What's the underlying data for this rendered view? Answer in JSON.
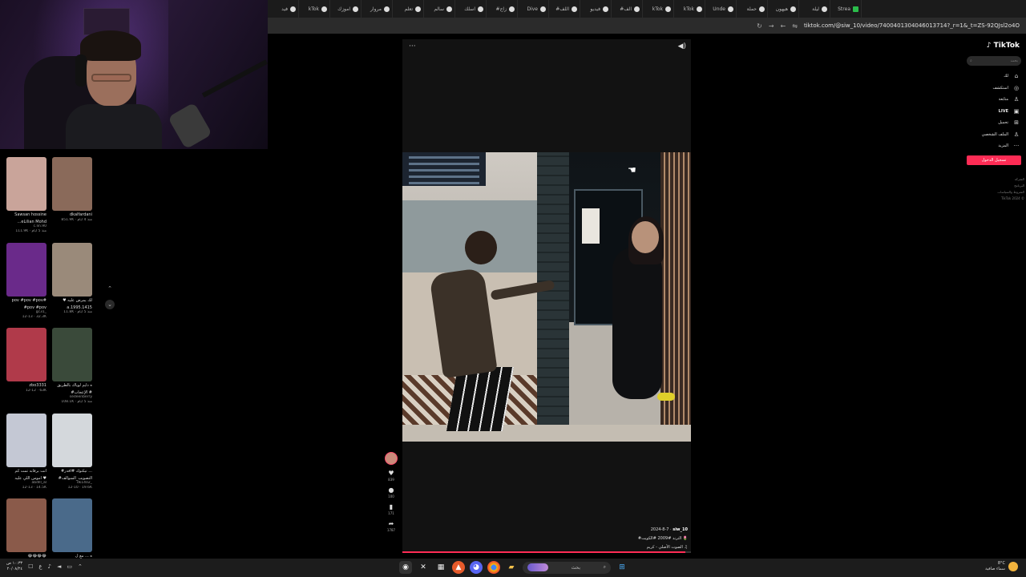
{
  "browser": {
    "tabs": [
      {
        "label": "فيد"
      },
      {
        "label": "kTok"
      },
      {
        "label": "اموزك"
      },
      {
        "label": "مروار"
      },
      {
        "label": "تعلم"
      },
      {
        "label": "سالم"
      },
      {
        "label": "اسلك"
      },
      {
        "label": "#زاج"
      },
      {
        "label": "Dive"
      },
      {
        "label": "#اللف"
      },
      {
        "label": "فيديو"
      },
      {
        "label": "#الف"
      },
      {
        "label": "kTok"
      },
      {
        "label": "kTok"
      },
      {
        "label": "Unde"
      },
      {
        "label": "حملة"
      },
      {
        "label": "هيهون"
      },
      {
        "label": "ليلة"
      },
      {
        "label": "Strea"
      }
    ],
    "url": "tiktok.com/@siw_10/video/7400401304046013714?_r=1&_t=ZS-92QJsl2o4O",
    "nav_back": "←",
    "nav_forward": "→",
    "reload": "↻"
  },
  "sidebar_grid": {
    "rows": [
      {
        "cards": [
          {
            "caption": "Sawsan hossine",
            "caption2": "...eLilian Mohd",
            "meta": "c.lin.90",
            "meta2": "111.9K · منذ 5 أيام",
            "color": "#c9a49a"
          },
          {
            "caption": "dkalfardani",
            "caption2": "",
            "meta": "851.9K · منذ 4 أيام",
            "meta2": "",
            "color": "#8a6a5a"
          }
        ]
      },
      {
        "cards": [
          {
            "caption": "pov #pov #pov#",
            "caption2": "#pov #pov",
            "meta": "gc31_",
            "meta2": "12-13 · 32.3K",
            "color": "#6a2a8a"
          },
          {
            "caption": "♥ لك يمرض عليه",
            "caption2": "a.1995.1415",
            "meta": "11.8K · منذ 5 أيام",
            "meta2": "",
            "color": "#9a8a7a"
          }
        ]
      },
      {
        "cards": [
          {
            "caption": "zbo3331",
            "caption2": "",
            "meta": "12-12 · 63K",
            "meta2": "",
            "color": "#b03a4a"
          },
          {
            "caption": "ه دايم لوياك بالطريق",
            "caption2": "#الإعجاب #",
            "meta": "sedeenberry",
            "meta2": "108.1K · منذ 5 أيام",
            "color": "#3a4a3a"
          }
        ]
      },
      {
        "cards": [
          {
            "caption": "انت برقابه تمت كم",
            "caption2": "اموس اللي عليه ♥",
            "meta": "abdlll_al",
            "meta2": "12-13 · 14.5K",
            "color": "#c4c8d4"
          },
          {
            "caption": "#تيكتوك #أقدر ...",
            "caption2": "#التصويب_السوالف",
            "meta": "dk1402_",
            "meta2": "12-10 · 19.6K",
            "color": "#d4d8dc"
          }
        ]
      },
      {
        "cards": [
          {
            "caption": "😂😂😂😂",
            "caption2": "",
            "meta": "",
            "meta2": "",
            "color": "#8a5a4a"
          },
          {
            "caption": "ه ... مع ل",
            "caption2": "",
            "meta": "",
            "meta2": "",
            "color": "#4a6a8a"
          }
        ]
      }
    ],
    "scroll_up": "⌃",
    "scroll_down": "⌄"
  },
  "video": {
    "more": "···",
    "speaker_icon": "speaker-icon",
    "actions": [
      {
        "name": "like",
        "icon": "♥",
        "count": "839"
      },
      {
        "name": "comment",
        "icon": "●",
        "count": "100"
      },
      {
        "name": "save",
        "icon": "▮",
        "count": "171"
      },
      {
        "name": "share",
        "icon": "➦",
        "count": "1787"
      }
    ],
    "author": "siw_10",
    "date": "2024-8-7 ·",
    "caption": "#الترند #2009 #الكويت 🌷",
    "sound": "الصوت الأصلي - كريم ♫",
    "progress_pct": 98
  },
  "tiktok_nav": {
    "logo": "TikTok",
    "search_placeholder": "بحث",
    "items": [
      {
        "label": "لك",
        "icon": "⌂"
      },
      {
        "label": "استكشف",
        "icon": "◎"
      },
      {
        "label": "متابعة",
        "icon": "♙"
      },
      {
        "label": "LIVE",
        "icon": "▣"
      },
      {
        "label": "تحميل",
        "icon": "⊞"
      },
      {
        "label": "الملف الشخصي",
        "icon": "♙"
      },
      {
        "label": "المزيد",
        "icon": "···"
      }
    ],
    "login": "تسجيل الدخول",
    "footer_links": [
      "الشركة",
      "البرنامج",
      "الشروط والسياسات",
      "TikTok 2024 ©"
    ]
  },
  "taskbar": {
    "clock_time": "١٠:٣٣ ص",
    "clock_date": "٢٠/٠٨/٢٤",
    "search_text": "بحث",
    "weather_temp": "8°C",
    "weather_desc": "سماء صافية"
  }
}
